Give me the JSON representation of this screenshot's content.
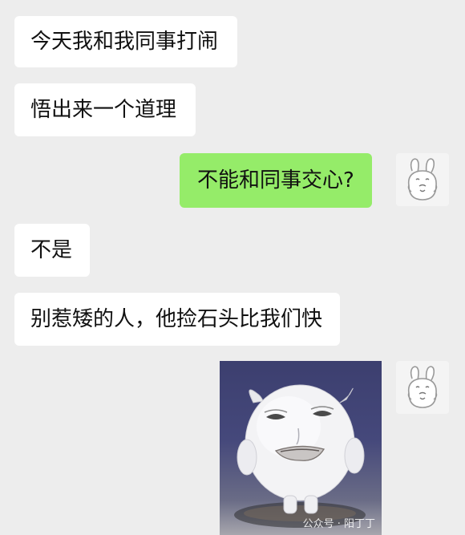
{
  "messages": [
    {
      "side": "left",
      "text": "今天我和我同事打闹"
    },
    {
      "side": "left",
      "text": "悟出来一个道理"
    },
    {
      "side": "right",
      "text": "不能和同事交心?"
    },
    {
      "side": "left",
      "text": "不是"
    },
    {
      "side": "left",
      "text": "别惹矮的人，他捡石头比我们快"
    }
  ],
  "sticker": {
    "icon": "round-white-creature-sticker-icon",
    "watermark": "公众号 · 阳丁丁"
  },
  "avatar": {
    "icon": "white-bunny-avatar-icon"
  },
  "colors": {
    "background": "#ededed",
    "left_bubble": "#ffffff",
    "right_bubble": "#95ec69",
    "text": "#111111"
  }
}
